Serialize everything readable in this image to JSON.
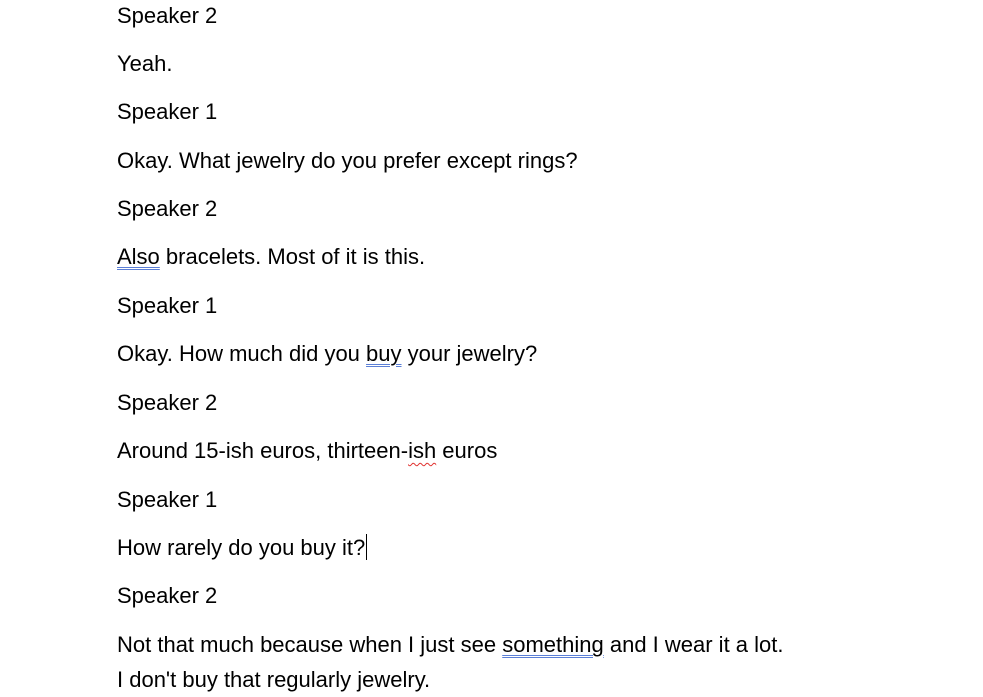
{
  "transcript": [
    {
      "text": "Speaker 2"
    },
    {
      "text": "Yeah."
    },
    {
      "text": "Speaker 1"
    },
    {
      "text": "Okay. What jewelry do you prefer except rings?"
    },
    {
      "text": "Speaker 2"
    },
    {
      "marked": "Also",
      "after": " bracelets. Most of it is this."
    },
    {
      "text": "Speaker 1"
    },
    {
      "before": "Okay. How much did you ",
      "marked": "buy",
      "after": " your jewelry?"
    },
    {
      "text": "Speaker 2"
    },
    {
      "before": "Around 15-ish euros, thirteen-",
      "marked": "ish",
      "after": " euros"
    },
    {
      "text": "Speaker 1"
    },
    {
      "text": "How rarely do you buy it?"
    },
    {
      "text": "Speaker 2"
    },
    {
      "before": "Not that much because when I just see ",
      "marked": "something",
      "after": " and I wear it a lot."
    },
    {
      "text": "I don't buy that regularly jewelry."
    }
  ],
  "colors": {
    "grammar_underline": "#5b7fd6",
    "spelling_underline": "#e0302e"
  }
}
